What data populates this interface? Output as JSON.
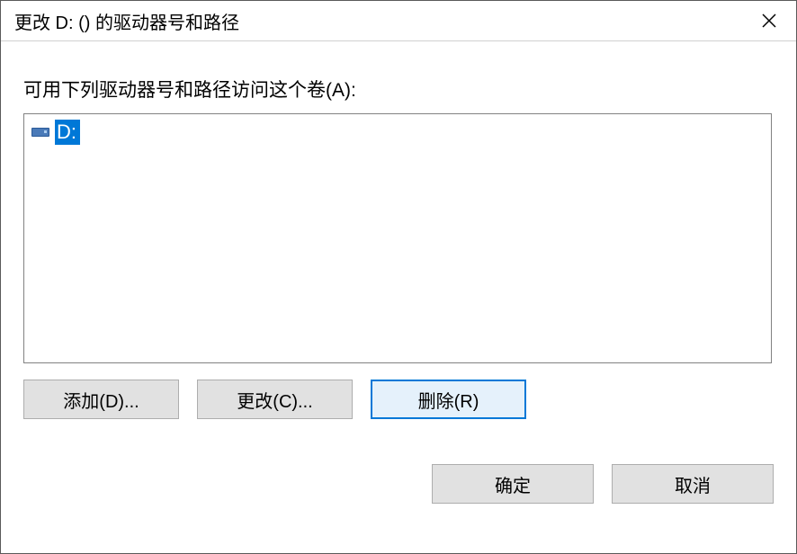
{
  "titlebar": {
    "title": "更改 D: () 的驱动器号和路径"
  },
  "content": {
    "description": "可用下列驱动器号和路径访问这个卷(A):",
    "list": {
      "items": [
        {
          "label": "D:",
          "selected": true
        }
      ]
    }
  },
  "buttons": {
    "add": "添加(D)...",
    "change": "更改(C)...",
    "remove": "删除(R)"
  },
  "footer": {
    "ok": "确定",
    "cancel": "取消"
  }
}
